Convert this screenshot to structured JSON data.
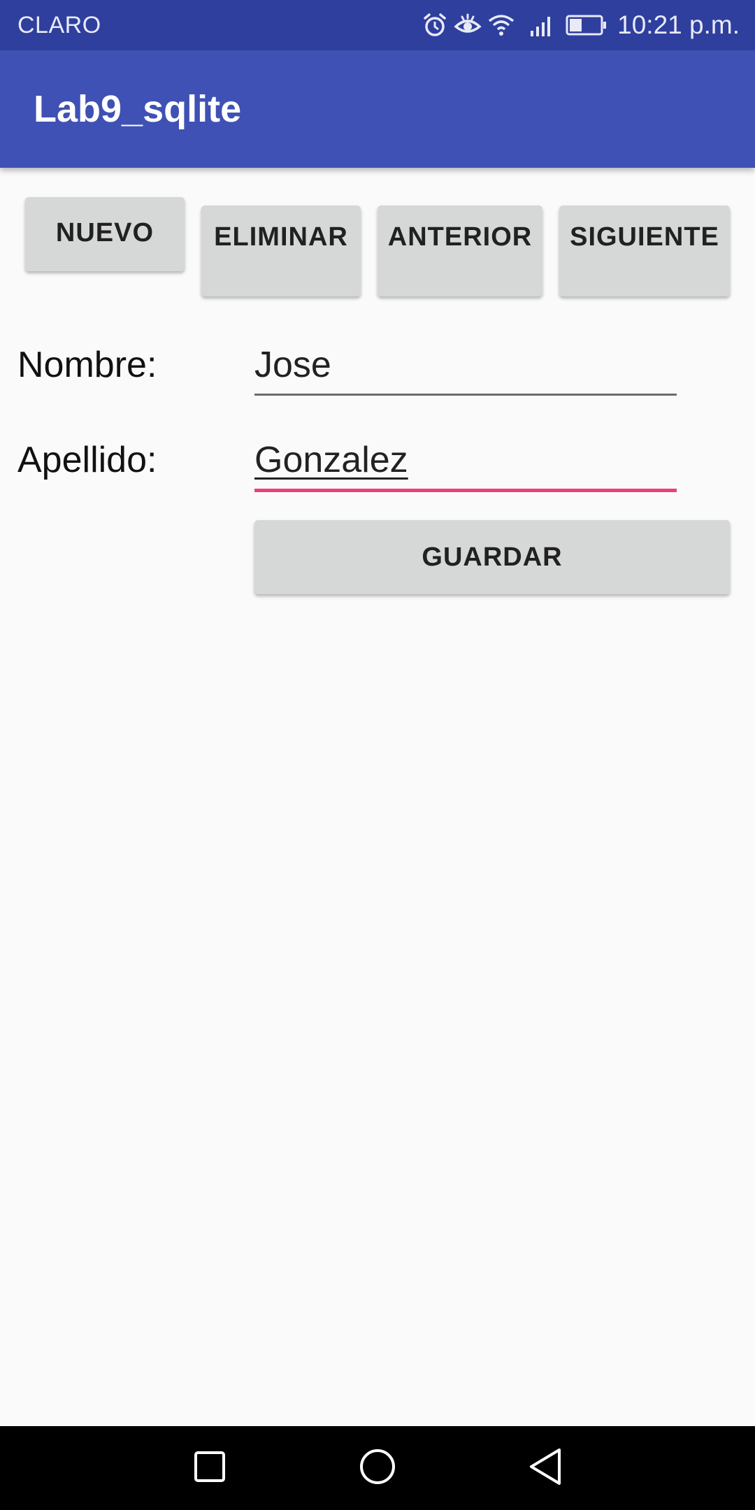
{
  "status_bar": {
    "carrier": "CLARO",
    "time": "10:21 p.m.",
    "icons": [
      "alarm-icon",
      "eye-icon",
      "wifi-icon",
      "signal-icon",
      "battery-icon"
    ],
    "battery_level": 0.4
  },
  "app_bar": {
    "title": "Lab9_sqlite"
  },
  "toolbar": {
    "nuevo_label": "NUEVO",
    "eliminar_label": "ELIMINAR",
    "anterior_label": "ANTERIOR",
    "siguiente_label": "SIGUIENTE"
  },
  "form": {
    "nombre_label": "Nombre:",
    "nombre_value": "Jose",
    "apellido_label": "Apellido:",
    "apellido_value": "Gonzalez",
    "guardar_label": "GUARDAR"
  },
  "nav_bar": {
    "icons": [
      "recents-icon",
      "home-icon",
      "back-icon"
    ]
  },
  "colors": {
    "status_bar": "#2f3f9e",
    "app_bar": "#3f51b5",
    "accent": "#ec407a",
    "button": "#d6d7d7",
    "background": "#fafafa"
  }
}
